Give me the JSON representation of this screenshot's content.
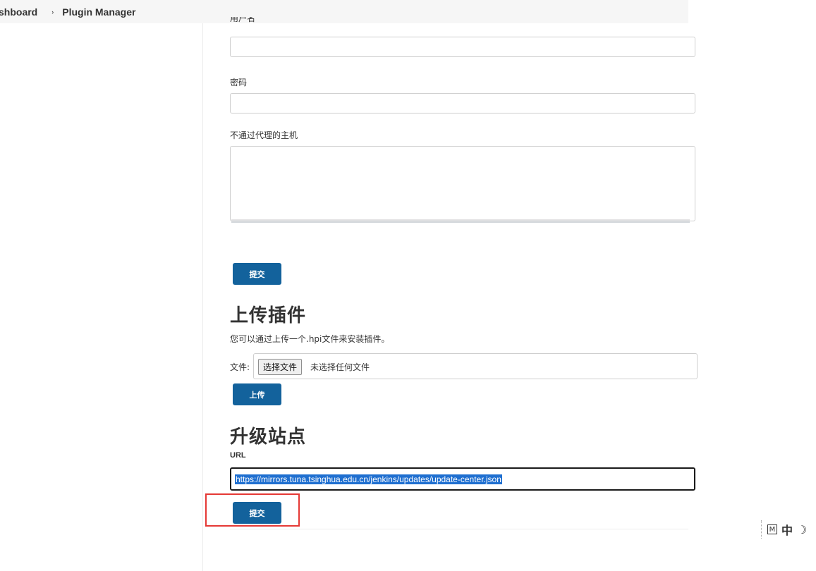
{
  "breadcrumb": {
    "dashboard": "shboard",
    "separator": "›",
    "current": "Plugin Manager"
  },
  "proxy": {
    "username_label": "用户名",
    "password_label": "密码",
    "no_proxy_hosts_label": "不通过代理的主机",
    "submit_label": "提交"
  },
  "upload": {
    "heading": "上传插件",
    "description": "您可以通过上传一个.hpi文件来安装插件。",
    "file_label": "文件:",
    "choose_button": "选择文件",
    "file_status": "未选择任何文件",
    "upload_button": "上传"
  },
  "update_site": {
    "heading": "升级站点",
    "url_label": "URL",
    "url_value": "https://mirrors.tuna.tsinghua.edu.cn/jenkins/updates/update-center.json",
    "submit_label": "提交"
  },
  "ime": {
    "mode_icon": "M",
    "language": "中",
    "half_width_icon": "moon-icon"
  },
  "colors": {
    "button_bg": "#13629c",
    "highlight": "#e53935",
    "selection": "#1f6fd0"
  }
}
